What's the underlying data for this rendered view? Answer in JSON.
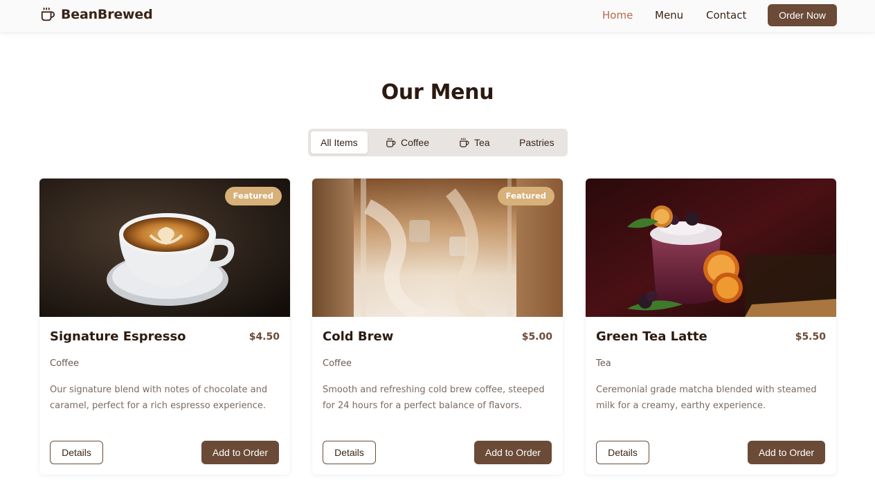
{
  "brand": {
    "name": "BeanBrewed",
    "icon": "coffee-cup-icon"
  },
  "nav": {
    "home": "Home",
    "menu": "Menu",
    "contact": "Contact",
    "order_now": "Order Now",
    "active": "Home"
  },
  "colors": {
    "accent": "#6b4a37",
    "active_nav": "#b5694a",
    "badge": "#d7b07a",
    "title": "#2b1a10"
  },
  "menu": {
    "title": "Our Menu",
    "filters": [
      {
        "label": "All Items",
        "icon": "",
        "active": true
      },
      {
        "label": "Coffee",
        "icon": "coffee-cup-icon",
        "active": false
      },
      {
        "label": "Tea",
        "icon": "coffee-cup-icon",
        "active": false
      },
      {
        "label": "Pastries",
        "icon": "",
        "active": false
      }
    ],
    "items": [
      {
        "name": "Signature Espresso",
        "price": "$4.50",
        "category": "Coffee",
        "description": "Our signature blend with notes of chocolate and caramel, perfect for a rich espresso experience.",
        "badge": "Featured",
        "details_label": "Details",
        "add_label": "Add to Order"
      },
      {
        "name": "Cold Brew",
        "price": "$5.00",
        "category": "Coffee",
        "description": "Smooth and refreshing cold brew coffee, steeped for 24 hours for a perfect balance of flavors.",
        "badge": "Featured",
        "details_label": "Details",
        "add_label": "Add to Order"
      },
      {
        "name": "Green Tea Latte",
        "price": "$5.50",
        "category": "Tea",
        "description": "Ceremonial grade matcha blended with steamed milk for a creamy, earthy experience.",
        "badge": "",
        "details_label": "Details",
        "add_label": "Add to Order"
      }
    ]
  }
}
